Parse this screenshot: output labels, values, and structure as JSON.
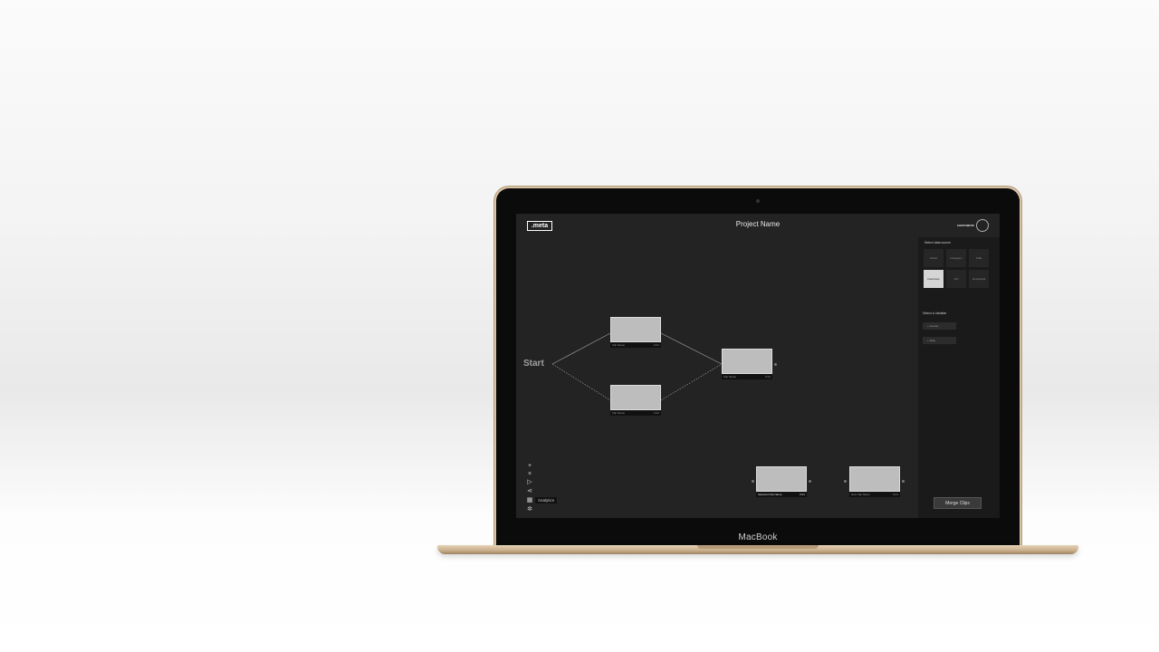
{
  "device": {
    "label": "MacBook"
  },
  "app": {
    "logo": ".meta",
    "project_title": "Project Name",
    "username": "username"
  },
  "canvas": {
    "start_label": "Start",
    "clips": [
      {
        "name": "Clip Name",
        "time": "0:21"
      },
      {
        "name": "Clip Name",
        "time": "0:21"
      },
      {
        "name": "Clip Name",
        "time": "0:21"
      }
    ],
    "merge_clips": [
      {
        "name": "Selected Clip Name",
        "time": "0:21"
      },
      {
        "name": "New Clip Name",
        "time": "0:21"
      }
    ]
  },
  "toolbar": {
    "tools": [
      {
        "icon": "plus-icon",
        "glyph": "+"
      },
      {
        "icon": "close-icon",
        "glyph": "×"
      },
      {
        "icon": "play-icon",
        "glyph": "▷"
      },
      {
        "icon": "share-icon",
        "glyph": "⋖"
      },
      {
        "icon": "analytics-icon",
        "glyph": "▦"
      },
      {
        "icon": "gear-icon",
        "glyph": "✲"
      }
    ],
    "tooltip": "Analytics"
  },
  "sidebar": {
    "data_source_heading": "Select data source",
    "sources": [
      "Twitter",
      "Instagram",
      "AIZE",
      "Facebook",
      "API",
      "Geospatial"
    ],
    "active_source_index": 3,
    "variable_heading": "Select a Variable",
    "variables": [
      "+ Gender",
      "+ Male"
    ],
    "merge_button": "Merge Clips"
  },
  "colors": {
    "screen_bg": "#232323",
    "sidebar_bg": "#1a1a1a",
    "clip_thumb": "#bdbdbd",
    "laptop_gold": "#d8c3a5"
  }
}
